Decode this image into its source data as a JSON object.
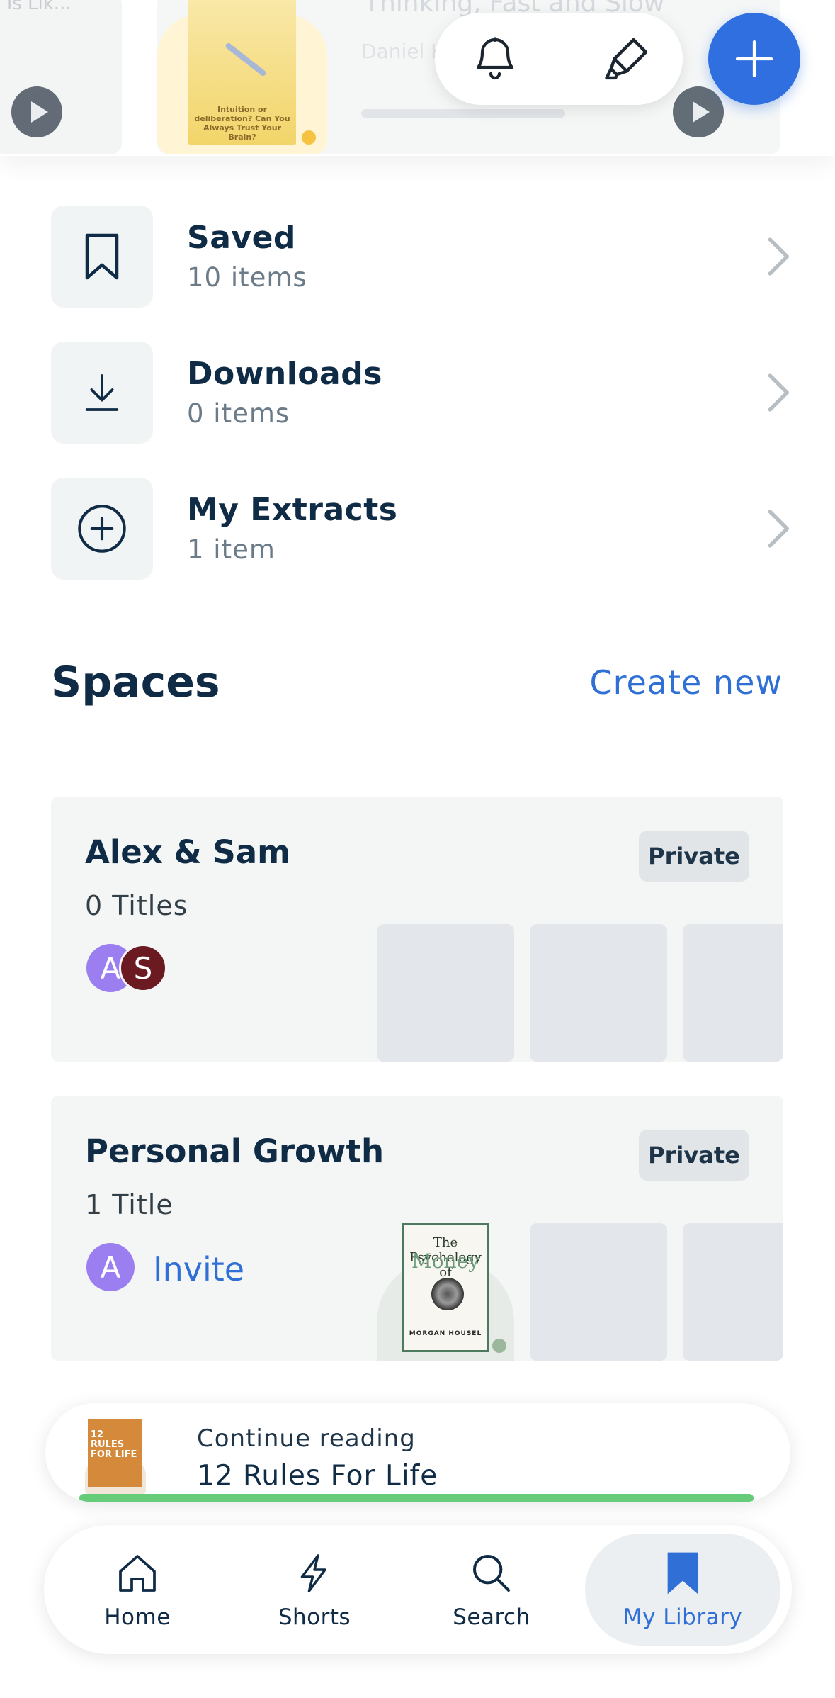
{
  "carousel": {
    "faded_left_text": "is Lik...",
    "book_cover_caption": "Intuition or deliberation? Can You Always Trust Your Brain?",
    "faded_title": "Thinking, Fast and Slow",
    "faded_author": "Daniel Kahneman"
  },
  "header_actions": {
    "bell_icon": "bell-icon",
    "highlighter_icon": "highlighter-icon",
    "add_icon": "plus-icon"
  },
  "library": [
    {
      "title": "Saved",
      "count": "10 items",
      "icon": "bookmark-outline-icon"
    },
    {
      "title": "Downloads",
      "count": "0 items",
      "icon": "download-icon"
    },
    {
      "title": "My Extracts",
      "count": "1 item",
      "icon": "plus-circle-icon"
    }
  ],
  "spaces": {
    "heading": "Spaces",
    "create_new": "Create new",
    "cards": [
      {
        "name": "Alex & Sam",
        "titles": "0 Titles",
        "badge": "Private",
        "avatars": [
          {
            "letter": "A",
            "color": "#9b7ff0"
          },
          {
            "letter": "S",
            "color": "#6b1a22"
          }
        ]
      },
      {
        "name": "Personal Growth",
        "titles": "1 Title",
        "badge": "Private",
        "avatars": [
          {
            "letter": "A",
            "color": "#9b7ff0"
          }
        ],
        "invite": "Invite",
        "book": {
          "title_line1": "The Psychology of",
          "title_line2": "Money",
          "author": "MORGAN HOUSEL"
        }
      }
    ]
  },
  "continue_reading": {
    "label": "Continue reading",
    "title": "12 Rules For Life",
    "cover_text": "12 RULES FOR LIFE",
    "progress": 1.0,
    "progress_color": "#66cc7a"
  },
  "bottom_nav": {
    "items": [
      {
        "label": "Home",
        "icon": "home-icon"
      },
      {
        "label": "Shorts",
        "icon": "lightning-icon"
      },
      {
        "label": "Search",
        "icon": "search-icon"
      },
      {
        "label": "My Library",
        "icon": "bookmark-filled-icon",
        "active": true
      }
    ]
  },
  "colors": {
    "accent": "#2f6fd6",
    "text_primary": "#0f2b45",
    "card_bg": "#f4f6f6"
  }
}
